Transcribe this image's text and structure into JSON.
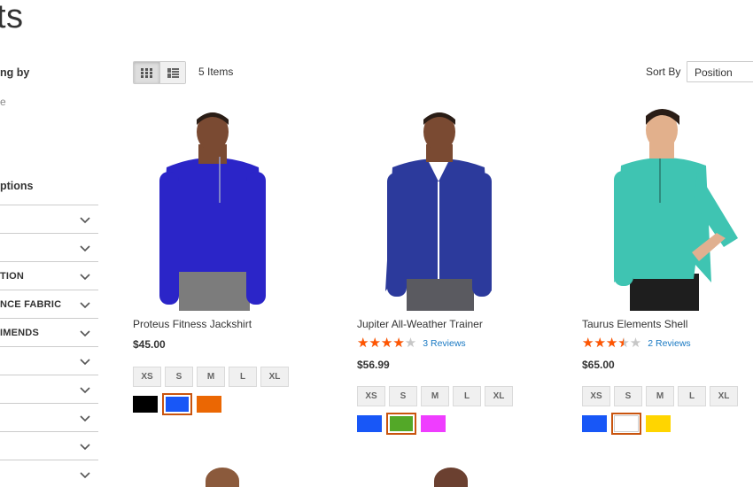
{
  "page": {
    "title": "ts"
  },
  "sidebar": {
    "shop_by": "ng by",
    "shop_sub": "e",
    "shop_options": "ptions",
    "filters": [
      "",
      "",
      "TION",
      "NCE FABRIC",
      "IMENDS",
      "",
      "",
      "",
      "",
      ""
    ]
  },
  "toolbar": {
    "items_count": "5 Items",
    "sort_label": "Sort By",
    "sort_value": "Position",
    "view_grid": "grid-icon",
    "view_list": "list-icon"
  },
  "products": [
    {
      "name": "Proteus Fitness Jackshirt",
      "price": "$45.00",
      "shirt_color": "#2b25c8",
      "sizes": [
        "XS",
        "S",
        "M",
        "L",
        "XL"
      ],
      "swatches": [
        "#000000",
        "#1857f7",
        "#eb6703"
      ],
      "selected_swatch": 1
    },
    {
      "name": "Jupiter All-Weather Trainer",
      "rating_percent": 80,
      "reviews": "3  Reviews",
      "price": "$56.99",
      "shirt_color": "#2c3a9c",
      "sizes": [
        "XS",
        "S",
        "M",
        "L",
        "XL"
      ],
      "swatches": [
        "#1857f7",
        "#53a828",
        "#ef3dff"
      ],
      "selected_swatch": 1
    },
    {
      "name": "Taurus Elements Shell",
      "rating_percent": 70,
      "reviews": "2  Reviews",
      "price": "$65.00",
      "shirt_color": "#3fc4b2",
      "sizes": [
        "XS",
        "S",
        "M",
        "L",
        "XL"
      ],
      "swatches": [
        "#1857f7",
        "#ffffff",
        "#ffd500"
      ],
      "selected_swatch": 1
    }
  ]
}
